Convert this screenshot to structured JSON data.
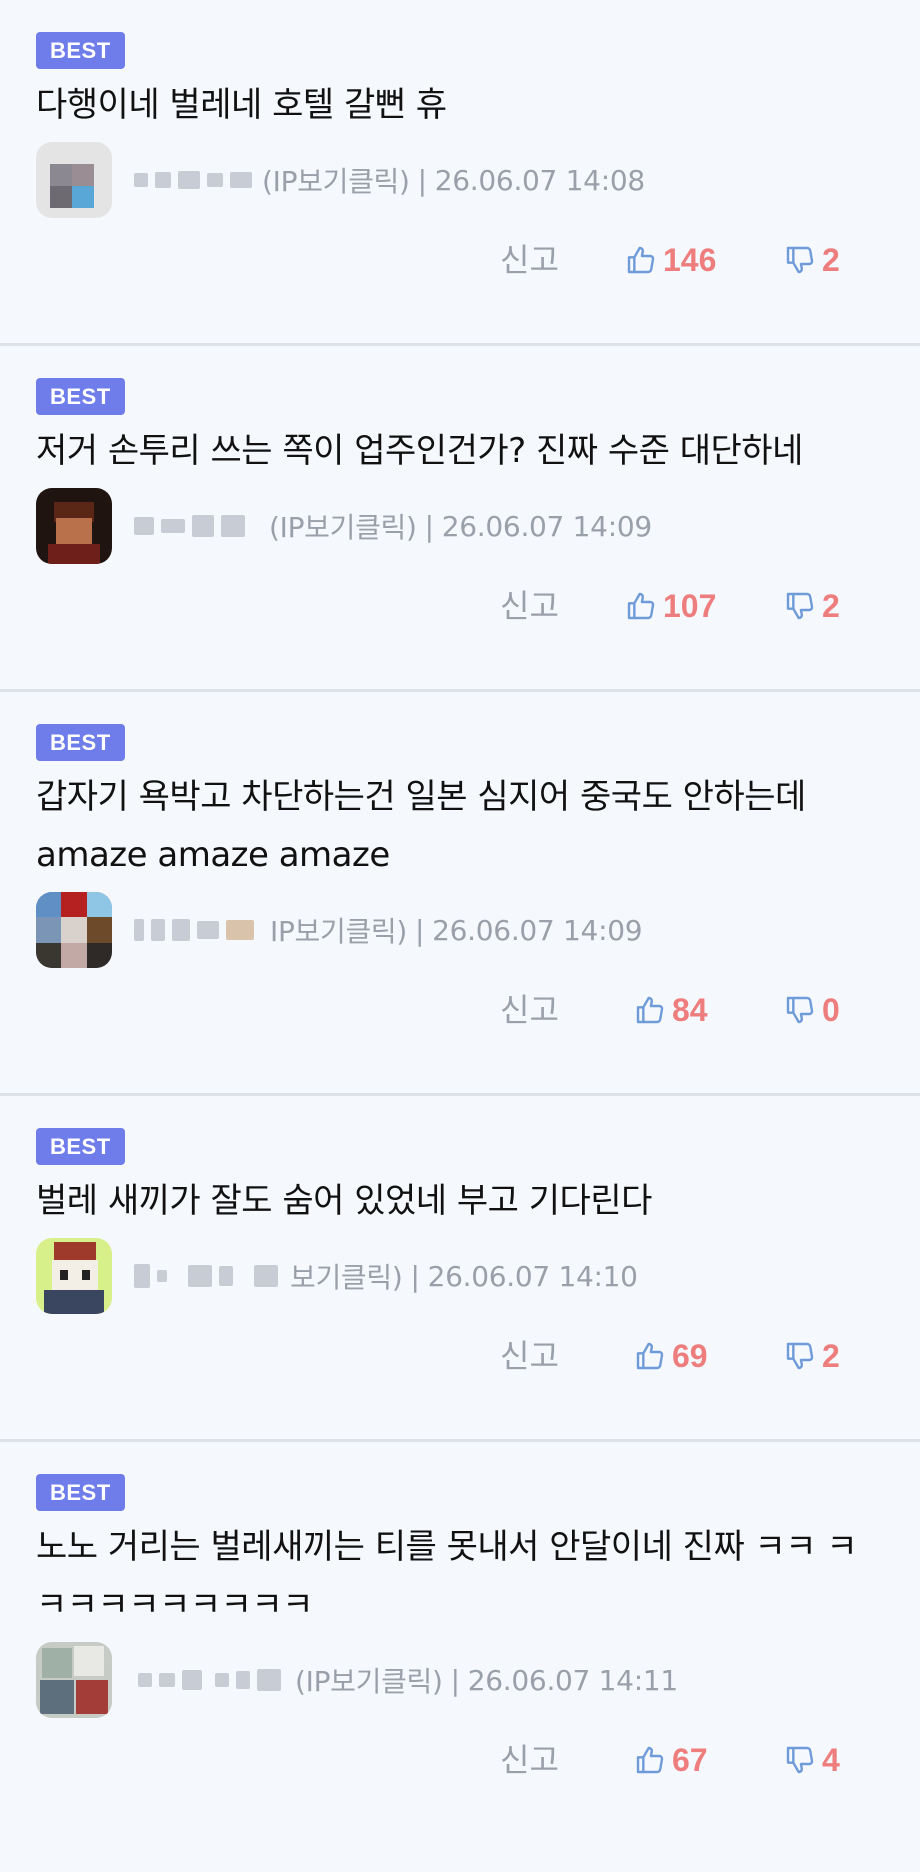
{
  "comments": [
    {
      "badge": "BEST",
      "text": "다행이네 벌레네 호텔 갈뻔 휴",
      "ip": "(IP보기클릭)",
      "sep": "|",
      "date": "26.06.07 14:08",
      "report": "신고",
      "up": "146",
      "down": "2"
    },
    {
      "badge": "BEST",
      "text": "저거 손투리 쓰는 쪽이 업주인건가? 진짜 수준 대단하네",
      "ip": "(IP보기클릭)",
      "sep": "|",
      "date": "26.06.07 14:09",
      "report": "신고",
      "up": "107",
      "down": "2"
    },
    {
      "badge": "BEST",
      "text": "갑자기 욕박고 차단하는건 일본 심지어 중국도 안하는데 amaze amaze amaze",
      "ip": "IP보기클릭)",
      "sep": "|",
      "date": "26.06.07 14:09",
      "report": "신고",
      "up": "84",
      "down": "0"
    },
    {
      "badge": "BEST",
      "text": "벌레 새끼가 잘도 숨어 있었네 부고 기다린다",
      "ip": "보기클릭)",
      "sep": "|",
      "date": "26.06.07 14:10",
      "report": "신고",
      "up": "69",
      "down": "2"
    },
    {
      "badge": "BEST",
      "text": "노노 거리는 벌레새끼는 티를 못내서 안달이네 진짜 ㅋㅋ ㅋㅋㅋㅋㅋㅋㅋㅋㅋㅋ",
      "ip": "(IP보기클릭)",
      "sep": "|",
      "date": "26.06.07 14:11",
      "report": "신고",
      "up": "67",
      "down": "4"
    }
  ],
  "colors": {
    "background": "#f5f8fd",
    "badge": "#6e7de9",
    "vote_count": "#ee7d7d",
    "thumb_icon": "#6f9bd8",
    "meta_text": "#9aa0aa",
    "divider": "#dde1e8"
  },
  "icons": {
    "avatar": "pixelated-avatar-image",
    "nickname": "pixelated-nickname",
    "up": "thumbs-up-icon",
    "down": "thumbs-down-icon"
  }
}
